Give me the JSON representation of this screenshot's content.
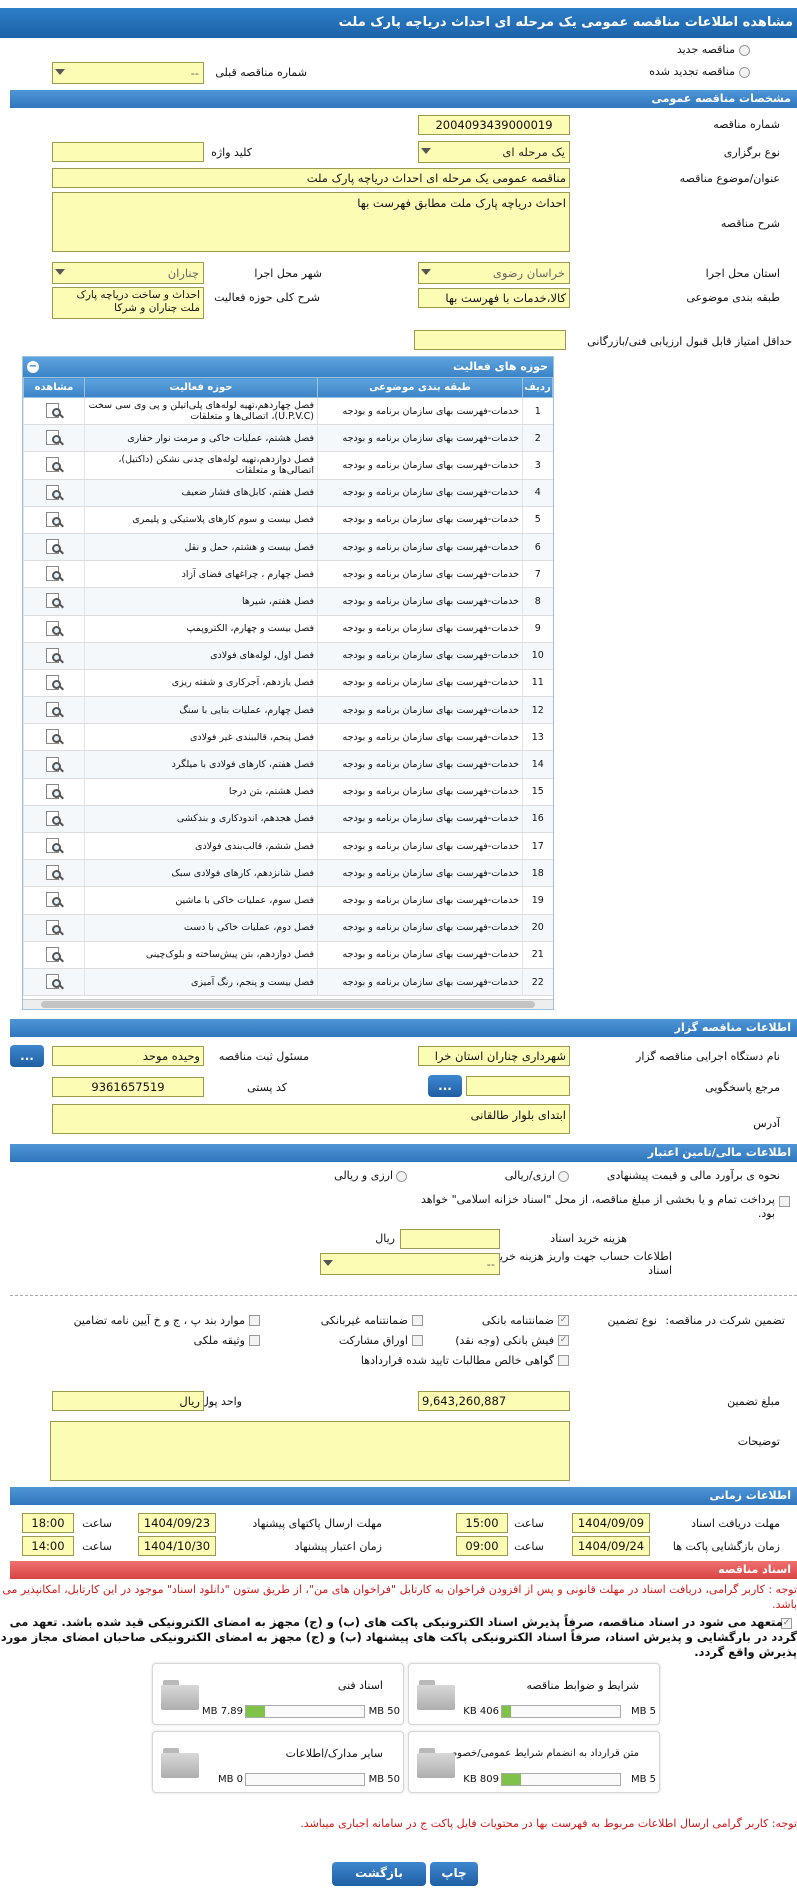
{
  "title": "مشاهده اطلاعات مناقصه عمومی یک مرحله ای احداث دریاچه پارک ملت",
  "top": {
    "new_tender": "مناقصه جدید",
    "renewed_tender": "مناقصه تجدید شده",
    "prev_number_label": "شماره مناقصه قبلی",
    "prev_number_value": "--"
  },
  "general": {
    "header": "مشخصات مناقصه عمومی",
    "number_label": "شماره مناقصه",
    "number_value": "2004093439000019",
    "organizer_type_label": "نوع برگزاری",
    "organizer_type_value": "یک مرحله ای",
    "keyword_label": "کلید واژه",
    "subject_label": "عنوان/موضوع مناقصه",
    "subject_value": "مناقصه عمومی یک مرحله ای احداث دریاچه پارک ملت",
    "description_label": "شرح مناقصه",
    "description_value": "احداث دریاچه پارک ملت مطابق فهرست بها",
    "province_label": "استان محل اجرا",
    "province_value": "خراسان رضوی",
    "city_label": "شهر محل اجرا",
    "city_value": "چناران",
    "category_label": "طبقه بندی موضوعی",
    "category_value": "کالا،خدمات با فهرست بها",
    "activity_desc_label": "شرح کلی حوزه فعالیت",
    "activity_desc_value": "احداث و ساخت دریاچه پارک ملت چناران و شرکا",
    "min_score_label": "حداقل امتیاز قابل قبول ارزیابی فنی/بازرگانی"
  },
  "activities": {
    "header": "حوزه های فعالیت",
    "col_row": "ردیف",
    "col_category": "طبقه بندی موضوعی",
    "col_activity": "حوزه فعالیت",
    "col_view": "مشاهده",
    "rows": [
      {
        "n": "1",
        "cat": "خدمات-فهرست بهای سازمان برنامه و بودجه",
        "act": "فصل چهاردهم،تهیه لوله‌های پلی‌اتیلن و پی وی سی سخت (U.P.V.C)، اتصالی‌ها و متعلقات"
      },
      {
        "n": "2",
        "cat": "خدمات-فهرست بهای سازمان برنامه و بودجه",
        "act": "فصل هشتم، عملیات خاکی و مرمت نوار حفاری"
      },
      {
        "n": "3",
        "cat": "خدمات-فهرست بهای سازمان برنامه و بودجه",
        "act": "فصل دوازدهم،تهیه لوله‌های چدنی نشکن (داکتیل)، اتصالی‌ها و متعلقات"
      },
      {
        "n": "4",
        "cat": "خدمات-فهرست بهای سازمان برنامه و بودجه",
        "act": "فصل هفتم، کابل‌های فشار ضعیف"
      },
      {
        "n": "5",
        "cat": "خدمات-فهرست بهای سازمان برنامه و بودجه",
        "act": "فصل بیست و سوم کارهای پلاستیکی و پلیمری"
      },
      {
        "n": "6",
        "cat": "خدمات-فهرست بهای سازمان برنامه و بودجه",
        "act": "فصل بیست و هشتم، حمل و نقل"
      },
      {
        "n": "7",
        "cat": "خدمات-فهرست بهای سازمان برنامه و بودجه",
        "act": "فصل چهارم ، چراغهای فضای آزاد"
      },
      {
        "n": "8",
        "cat": "خدمات-فهرست بهای سازمان برنامه و بودجه",
        "act": "فصل هفتم، شیرها"
      },
      {
        "n": "9",
        "cat": "خدمات-فهرست بهای سازمان برنامه و بودجه",
        "act": "فصل بیست و چهارم، الکتروپمپ"
      },
      {
        "n": "10",
        "cat": "خدمات-فهرست بهای سازمان برنامه و بودجه",
        "act": "فصل اول، لوله‌های فولادی"
      },
      {
        "n": "11",
        "cat": "خدمات-فهرست بهای سازمان برنامه و بودجه",
        "act": "فصل یازدهم، آجرکاری و شفته ریزی"
      },
      {
        "n": "12",
        "cat": "خدمات-فهرست بهای سازمان برنامه و بودجه",
        "act": "فصل چهارم، عملیات بنایی با سنگ"
      },
      {
        "n": "13",
        "cat": "خدمات-فهرست بهای سازمان برنامه و بودجه",
        "act": "فصل پنجم، قالببندی غیر فولادی"
      },
      {
        "n": "14",
        "cat": "خدمات-فهرست بهای سازمان برنامه و بودجه",
        "act": "فصل هفتم، کارهای فولادی با میلگرد"
      },
      {
        "n": "15",
        "cat": "خدمات-فهرست بهای سازمان برنامه و بودجه",
        "act": "فصل هشتم، بتن درجا"
      },
      {
        "n": "16",
        "cat": "خدمات-فهرست بهای سازمان برنامه و بودجه",
        "act": "فصل هجدهم، اندودکاری و بندکشی"
      },
      {
        "n": "17",
        "cat": "خدمات-فهرست بهای سازمان برنامه و بودجه",
        "act": "فصل ششم، قالب‌بندی فولادی"
      },
      {
        "n": "18",
        "cat": "خدمات-فهرست بهای سازمان برنامه و بودجه",
        "act": "فصل شانزدهم، کارهای فولادی سبک"
      },
      {
        "n": "19",
        "cat": "خدمات-فهرست بهای سازمان برنامه و بودجه",
        "act": "فصل سوم، عملیات خاکی با ماشین"
      },
      {
        "n": "20",
        "cat": "خدمات-فهرست بهای سازمان برنامه و بودجه",
        "act": "فصل دوم، عملیات خاکی با دست"
      },
      {
        "n": "21",
        "cat": "خدمات-فهرست بهای سازمان برنامه و بودجه",
        "act": "فصل دوازدهم، بتن پیش‌ساخته و بلوک‌چینی"
      },
      {
        "n": "22",
        "cat": "خدمات-فهرست بهای سازمان برنامه و بودجه",
        "act": "فصل بیست و پنجم، رنگ آمیزی"
      }
    ]
  },
  "organizer": {
    "header": "اطلاعات مناقصه گزار",
    "org_label": "نام دستگاه اجرایی مناقصه گزار",
    "org_value": "شهرداری چناران استان خرا",
    "registrar_label": "مسئول ثبت مناقصه",
    "registrar_value": "وحیده موحد",
    "responder_label": "مرجع پاسخگویی",
    "postal_label": "کد پستی",
    "postal_value": "9361657519",
    "address_label": "آدرس",
    "address_value": "ابتدای بلوار طالقانی",
    "browse": "..."
  },
  "finance": {
    "header": "اطلاعات مالی/تامین اعتبار",
    "estimate_label": "نحوه ی برآورد مالی و قیمت پیشنهادی",
    "opt_rial": "ارزی/ریالی",
    "opt_fx": "ارزی و ریالی",
    "treasury_text": "پرداخت تمام و یا بخشی از مبلغ مناقصه، از محل \"اسناد خزانه اسلامی\" خواهد بود.",
    "doc_cost_label": "هزینه خرید اسناد",
    "doc_cost_unit": "ریال",
    "account_label": "اطلاعات حساب جهت واریز هزینه خرید اسناد",
    "account_value": "--"
  },
  "guarantee": {
    "participation_label": "تضمین شرکت در مناقصه:",
    "type_label": "نوع تضمین",
    "o1": "ضمانتنامه بانکی",
    "o2": "ضمانتنامه غیربانکی",
    "o3": "موارد بند پ ، ج و خ آیین نامه تضامین",
    "o4": "فیش بانکی (وجه نقد)",
    "o5": "اوراق مشارکت",
    "o6": "وثیقه ملکی",
    "o7": "گواهی خالص مطالبات تایید شده قراردادها",
    "amount_label": "مبلغ تضمین",
    "amount_value": "9,643,260,887",
    "currency_label": "واحد پول",
    "currency_value": "ریال",
    "notes_label": "توضیحات"
  },
  "timing": {
    "header": "اطلاعات زمانی",
    "doc_deadline_label": "مهلت دریافت اسناد",
    "doc_deadline_date": "1404/09/09",
    "doc_deadline_time": "15:00",
    "send_deadline_label": "مهلت ارسال پاکتهای پیشنهاد",
    "send_deadline_date": "1404/09/23",
    "send_deadline_time": "18:00",
    "open_label": "زمان بازگشایی پاکت ها",
    "open_date": "1404/09/24",
    "open_time": "09:00",
    "validity_label": "زمان اعتبار پیشنهاد",
    "validity_date": "1404/10/30",
    "validity_time": "14:00",
    "time_label": "ساعت"
  },
  "docs": {
    "header": "اسناد مناقصه",
    "note1": "توجه : کاربر گرامی، دریافت اسناد در مهلت قانونی و پس از افزودن فراخوان به کارتابل \"فراخوان های من\"، از طریق ستون \"دانلود اسناد\" موجود در این کارتابل، امکانپذیر می باشد.",
    "note2": "متعهد می شود در اسناد مناقصه، صرفاً پذیرش اسناد الکترونیکی پاکت های (ب) و (ج) مجهز به امضای الکترونیکی قید شده باشد. تعهد می گردد در بارگشایی و پذیرش اسناد، صرفاً اسناد الکترونیکی پاکت های پیشنهاد (ب) و (ج) مجهز به امضای الکترونیکی صاحبان امضای مجاز مورد پذیرش واقع گردد.",
    "files": [
      {
        "name": "شرایط و ضوابط مناقصه",
        "used": "406 KB",
        "max": "5 MB",
        "fill": 0.08
      },
      {
        "name": "اسناد فنی",
        "used": "7.89 MB",
        "max": "50 MB",
        "fill": 0.16
      },
      {
        "name": "متن قرارداد به انضمام شرایط عمومی/خصوصی",
        "used": "809 KB",
        "max": "5 MB",
        "fill": 0.16
      },
      {
        "name": "سایر مدارک/اطلاعات",
        "used": "0 MB",
        "max": "50 MB",
        "fill": 0
      }
    ],
    "note3": "توجه: کاربر گرامی ارسال اطلاعات مربوط به فهرست بها در محتویات فایل پاکت ج در سامانه اجباری میباشد.",
    "print": "چاپ",
    "back": "بازگشت"
  }
}
